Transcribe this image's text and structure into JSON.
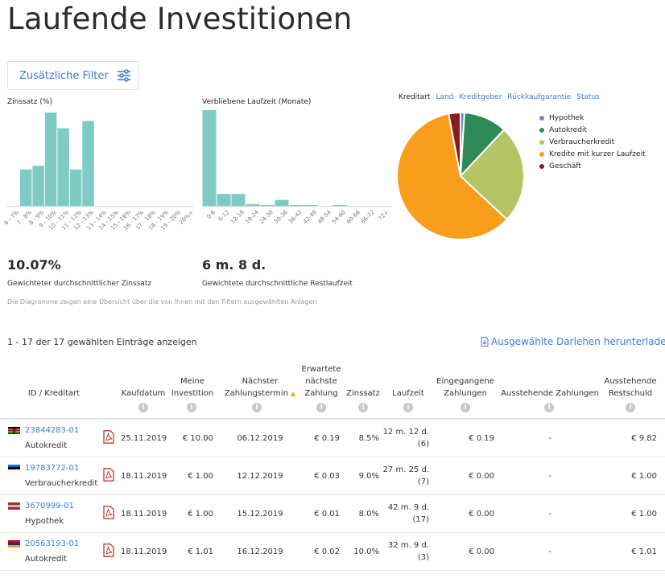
{
  "page": {
    "title": "Laufende Investitionen"
  },
  "filter": {
    "label": "Zusätzliche Filter"
  },
  "interest_chart": {
    "title": "Zinssatz (%)",
    "ticks": [
      "6 - 7%",
      "7 - 8%",
      "8 - 9%",
      "9 - 10%",
      "10 - 11%",
      "11 - 12%",
      "12 - 13%",
      "13 - 14%",
      "14 - 15%",
      "15 - 16%",
      "16 - 17%",
      "17 - 18%",
      "18 - 19%",
      "19 - 20%",
      "20%+"
    ],
    "values": [
      0,
      3,
      3.3,
      7.7,
      6.4,
      3,
      7,
      0,
      0,
      0,
      0,
      0,
      0,
      0,
      0
    ],
    "ymax": 7.9
  },
  "term_chart": {
    "title": "Verbliebene Laufzeit (Monate)",
    "ticks": [
      "0-6",
      "6-12",
      "12-18",
      "18-24",
      "24-30",
      "30-36",
      "36-42",
      "42-48",
      "48-54",
      "54-60",
      "60-66",
      "66-72",
      "72+"
    ],
    "values": [
      11.3,
      1.4,
      1.4,
      0.2,
      0.1,
      0.7,
      0.1,
      0.1,
      0,
      0.1,
      0,
      0,
      0
    ],
    "ymax": 11.3
  },
  "stats": {
    "rate_value": "10.07%",
    "rate_label": "Gewichteter durchschnittlicher Zinssatz",
    "term_value": "6 m. 8 d.",
    "term_label": "Gewichtete durchschnittliche Restlaufzeit",
    "note": "Die Diagramme zeigen eine Übersicht über die von Ihnen mit den Filtern ausgewählten Anlagen"
  },
  "pie_tabs": [
    "Kreditart",
    "Land",
    "Kreditgeber",
    "Rückkaufgarantie",
    "Status"
  ],
  "chart_data": {
    "type": "pie",
    "labels": [
      "Hypothek",
      "Autokredit",
      "Verbraucherkredit",
      "Kredite mit kurzer Laufzeit",
      "Geschäft"
    ],
    "values": [
      1,
      11,
      25,
      60,
      3
    ],
    "colors": [
      "#6f86c9",
      "#2e8b57",
      "#b5c565",
      "#f99d1c",
      "#8b1a1a"
    ]
  },
  "listing": {
    "showing": "1 - 17 der 17 gewählten Einträge anzeigen",
    "download": "Ausgewählte Darlehen herunterladen"
  },
  "table": {
    "headers": [
      {
        "text": "ID / Kreditart"
      },
      {
        "text": "Kaufdatum"
      },
      {
        "text": "Meine Investition"
      },
      {
        "text": "Nächster Zahlungstermin"
      },
      {
        "text": "Erwartete nächste Zahlung"
      },
      {
        "text": "Zinssatz"
      },
      {
        "text": "Laufzeit"
      },
      {
        "text": "Eingegangene Zahlungen"
      },
      {
        "text": "Ausstehende Zahlungen"
      },
      {
        "text": "Ausstehende Restschuld"
      }
    ],
    "rows": [
      {
        "id": "23844283-01",
        "type": "Autokredit",
        "date": "25.11.2019",
        "investment": "€ 10.00",
        "next_date": "06.12.2019",
        "next_payment": "€ 0.19",
        "rate": "8.5%",
        "term1": "12 m. 12 d.",
        "term2": "(6)",
        "received": "€ 0.19",
        "outstanding": "-",
        "principal": "€ 9.82",
        "flag": "ke"
      },
      {
        "id": "19783772-01",
        "type": "Verbraucherkredit",
        "date": "18.11.2019",
        "investment": "€ 1.00",
        "next_date": "12.12.2019",
        "next_payment": "€ 0.03",
        "rate": "9.0%",
        "term1": "27 m. 25 d.",
        "term2": "(7)",
        "received": "€ 0.00",
        "outstanding": "-",
        "principal": "€ 1.00",
        "flag": "ee"
      },
      {
        "id": "3670999-01",
        "type": "Hypothek",
        "date": "18.11.2019",
        "investment": "€ 1.00",
        "next_date": "15.12.2019",
        "next_payment": "€ 0.01",
        "rate": "8.0%",
        "term1": "42 m. 9 d.",
        "term2": "(17)",
        "received": "€ 0.00",
        "outstanding": "-",
        "principal": "€ 1.00",
        "flag": "lv"
      },
      {
        "id": "20563193-01",
        "type": "Autokredit",
        "date": "18.11.2019",
        "investment": "€ 1.01",
        "next_date": "16.12.2019",
        "next_payment": "€ 0.02",
        "rate": "10.0%",
        "term1": "32 m. 9 d.",
        "term2": "(3)",
        "received": "€ 0.00",
        "outstanding": "-",
        "principal": "€ 1.01",
        "flag": "am"
      }
    ]
  }
}
